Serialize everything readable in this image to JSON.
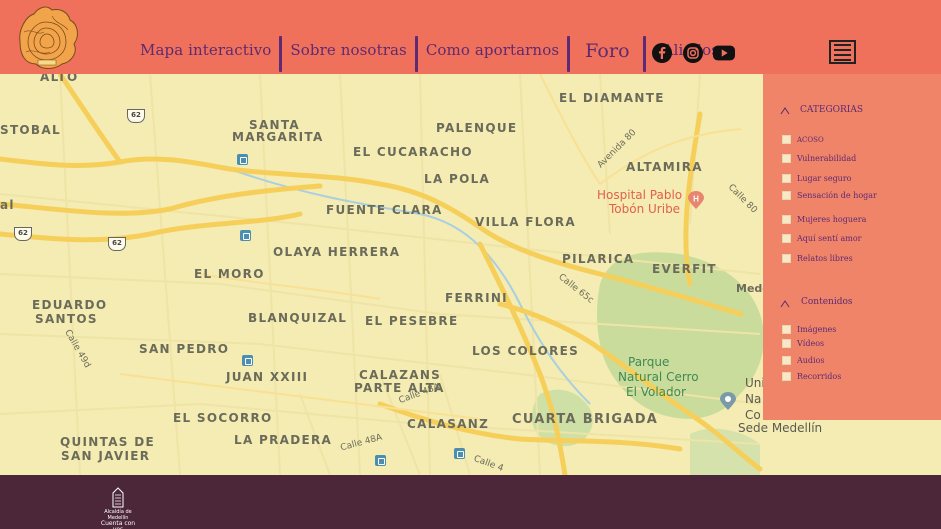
{
  "header": {
    "nav": [
      {
        "label": "Mapa interactivo"
      },
      {
        "label": "Sobre nosotras"
      },
      {
        "label": "Como aportarnos"
      },
      {
        "label": "Foro"
      },
      {
        "label": "Aliados"
      }
    ],
    "social": [
      "facebook-icon",
      "instagram-icon",
      "youtube-icon"
    ],
    "menu_icon": "hamburger-menu-icon"
  },
  "map": {
    "places": [
      {
        "label": "Alto"
      },
      {
        "label": "Stobal"
      },
      {
        "label": "Santa"
      },
      {
        "label": "Margarita"
      },
      {
        "label": "Palenque"
      },
      {
        "label": "El Diamante"
      },
      {
        "label": "El Cucaracho"
      },
      {
        "label": "Altamira"
      },
      {
        "label": "La Pola"
      },
      {
        "label": "Fuente Clara"
      },
      {
        "label": "Villa Flora"
      },
      {
        "label": "Olaya Herrera"
      },
      {
        "label": "El Moro"
      },
      {
        "label": "Pilarica"
      },
      {
        "label": "Everfit"
      },
      {
        "label": "Ferrini"
      },
      {
        "label": "Eduardo"
      },
      {
        "label": "Santos"
      },
      {
        "label": "Blanquizal"
      },
      {
        "label": "El Pesebre"
      },
      {
        "label": "San Pedro"
      },
      {
        "label": "Los Colores"
      },
      {
        "label": "Juan XXIII"
      },
      {
        "label": "Calazans"
      },
      {
        "label": "Parte Alta"
      },
      {
        "label": "El Socorro"
      },
      {
        "label": "Calasanz"
      },
      {
        "label": "Cuarta Brigada"
      },
      {
        "label": "Quintas de"
      },
      {
        "label": "San Javier"
      },
      {
        "label": "La Pradera"
      },
      {
        "label": "al"
      }
    ],
    "streets": [
      {
        "label": "Avenida 80"
      },
      {
        "label": "Calle 65c"
      },
      {
        "label": "Calle 48A"
      },
      {
        "label": "Calle 48A"
      },
      {
        "label": "Calle 4"
      },
      {
        "label": "Calle 49d"
      },
      {
        "label": "Calle 80"
      },
      {
        "label": "Mede"
      }
    ],
    "pois": {
      "hospital": "Hospital Pablo\nTobón Uribe",
      "hospital_line1": "Hospital Pablo",
      "hospital_line2": "Tobón Uribe",
      "park_line1": "Parque",
      "park_line2": "Natural Cerro",
      "park_line3": "El Volador",
      "univ_line1": "Uni",
      "univ_line2": "Na",
      "univ_line3": "Co",
      "univ_line4": "Sede Medellín"
    },
    "shields": [
      "62",
      "62",
      "62",
      "62"
    ]
  },
  "filters": {
    "categorias_title": "CATEGORIAS",
    "categorias": [
      {
        "label": "ACOSO"
      },
      {
        "label": "Vulnerabilidad"
      },
      {
        "label": "Lugar seguro"
      },
      {
        "label": "Sensación de hogar"
      },
      {
        "label": "Mujeres hoguera"
      },
      {
        "label": "Aquí sentí amor"
      },
      {
        "label": "Relatos libres"
      }
    ],
    "contenidos_title": "Contenidos",
    "contenidos": [
      {
        "label": "Imágenes"
      },
      {
        "label": "Vídeos"
      },
      {
        "label": "Audios"
      },
      {
        "label": "Recorridos"
      }
    ]
  },
  "footer": {
    "logo_text_line1": "Alcaldía de Medellín",
    "logo_text_line2": "Cuenta con vos"
  },
  "colors": {
    "header_bg": "#ef705b",
    "panel_bg": "#ef8469",
    "footer_bg": "#4b2739",
    "text_purple": "#5e2a72",
    "map_bg": "#f4ecb3",
    "road_major": "#f6cf5a"
  }
}
